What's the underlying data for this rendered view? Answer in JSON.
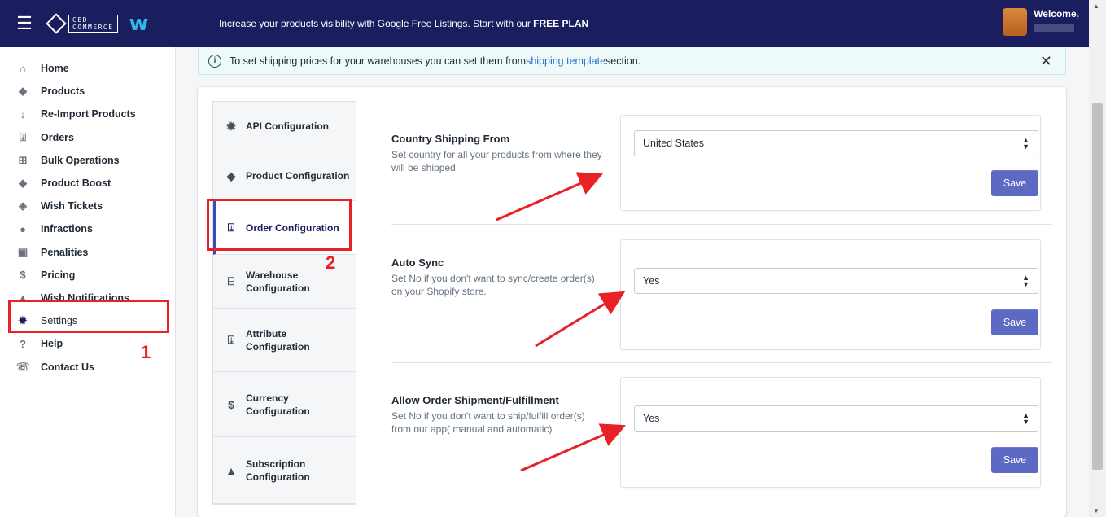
{
  "topbar": {
    "brand_box": "CED\nCOMMERCE",
    "brand_w": "w",
    "promo_text": "Increase your products visibility with Google Free Listings. Start with our ",
    "promo_bold": "FREE PLAN",
    "welcome": "Welcome,"
  },
  "sidebar": {
    "items": [
      {
        "label": "Home",
        "icon": "home-icon"
      },
      {
        "label": "Products",
        "icon": "tag-icon"
      },
      {
        "label": "Re-Import Products",
        "icon": "arrow-down-icon"
      },
      {
        "label": "Orders",
        "icon": "orders-icon"
      },
      {
        "label": "Bulk Operations",
        "icon": "bulk-icon"
      },
      {
        "label": "Product Boost",
        "icon": "tag-icon"
      },
      {
        "label": "Wish Tickets",
        "icon": "ticket-icon"
      },
      {
        "label": "Infractions",
        "icon": "alert-icon"
      },
      {
        "label": "Penalities",
        "icon": "penalty-icon"
      },
      {
        "label": "Pricing",
        "icon": "dollar-icon"
      },
      {
        "label": "Wish Notifications",
        "icon": "bell-icon"
      },
      {
        "label": "Settings",
        "icon": "gear-icon",
        "active": true
      },
      {
        "label": "Help",
        "icon": "help-icon"
      },
      {
        "label": "Contact Us",
        "icon": "phone-icon"
      }
    ]
  },
  "banner": {
    "text_before": "To set shipping prices for your warehouses you can set them from ",
    "link": "shipping template",
    "text_after": " section.",
    "close": "✕"
  },
  "tabs": [
    {
      "label": "API Configuration",
      "icon": "gear-icon"
    },
    {
      "label": "Product Configuration",
      "icon": "tag-icon"
    },
    {
      "label": "Order Configuration",
      "icon": "orders-icon",
      "active": true
    },
    {
      "label": "Warehouse Configuration",
      "icon": "warehouse-icon"
    },
    {
      "label": "Attribute Configuration",
      "icon": "orders-icon"
    },
    {
      "label": "Currency Configuration",
      "icon": "dollar-icon"
    },
    {
      "label": "Subscription Configuration",
      "icon": "bell-icon"
    }
  ],
  "sections": [
    {
      "title": "Country Shipping From",
      "desc": "Set country for all your products from where they will be shipped.",
      "value": "United States",
      "save": "Save"
    },
    {
      "title": "Auto Sync",
      "desc": "Set No if you don't want to sync/create order(s) on your Shopify store.",
      "value": "Yes",
      "save": "Save"
    },
    {
      "title": "Allow Order Shipment/Fulfillment",
      "desc": "Set No if you don't want to ship/fulfill order(s) from our app( manual and automatic).",
      "value": "Yes",
      "save": "Save"
    }
  ],
  "annotations": {
    "step1": "1",
    "step2": "2",
    "color": "#ea2027"
  },
  "colors": {
    "topbar": "#1b1e5e",
    "save_button": "#5c6ac4",
    "link": "#2c6ecb"
  }
}
